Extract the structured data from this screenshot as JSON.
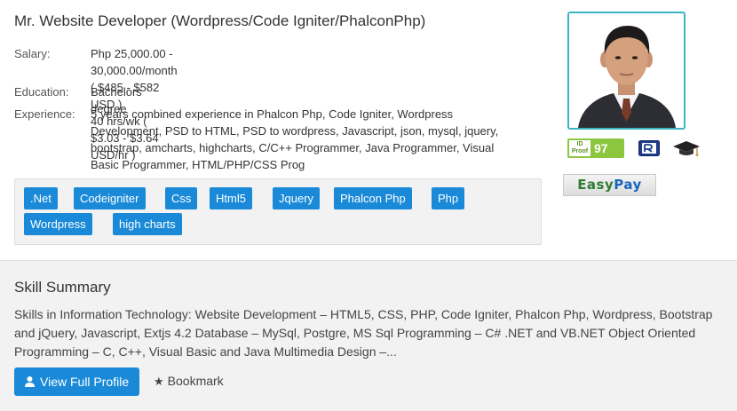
{
  "profile": {
    "title": "Mr. Website Developer (Wordpress/Code Igniter/PhalconPhp)",
    "salary_label": "Salary:",
    "salary_line1": "Php 25,000.00 - 30,000.00/month ( $485 - $582 USD )",
    "salary_line2": "40 hrs/wk ( $3.03 - $3.64 USD/hr )",
    "education_label": "Education:",
    "education_value": "Bachelors degree",
    "experience_label": "Experience:",
    "experience_lines": [
      "5 years combined experience in Phalcon Php, Code Igniter, Wordpress",
      "Development, PSD to HTML, PSD to wordpress, Javascript, json, mysql, jquery,",
      "bootstrap, amcharts, highcharts, C/C++ Programmer, Java Programmer, Visual",
      "Basic Programmer, HTML/PHP/CSS Prog"
    ],
    "tags": [
      ".Net",
      "Codeigniter",
      "Css",
      "Html5",
      "Jquery",
      "Phalcon Php",
      "Php",
      "Wordpress",
      "high charts"
    ]
  },
  "badges": {
    "id_proof_label_top": "ID",
    "id_proof_label_bottom": "Proof",
    "id_proof_score": "97",
    "icons": [
      "id-proof-badge-icon",
      "r-badge-icon",
      "graduation-cap-icon"
    ]
  },
  "easypay": {
    "part1": "Easy",
    "part2": "Pay"
  },
  "skills": {
    "title": "Skill Summary",
    "text": "Skills in Information Technology: Website Development – HTML5, CSS, PHP, Code Igniter, Phalcon Php, Wordpress, Bootstrap and jQuery, Javascript, Extjs 4.2 Database – MySql, Postgre, MS Sql Programming – C# .NET and VB.NET Object Oriented Programming – C, C++, Visual Basic and Java Multimedia Design –..."
  },
  "actions": {
    "view_profile_label": "View Full Profile",
    "bookmark_label": "Bookmark"
  },
  "colors": {
    "accent": "#1a8ad8",
    "photo_border": "#3bb3c3",
    "id_proof_green": "#8cc63f"
  }
}
